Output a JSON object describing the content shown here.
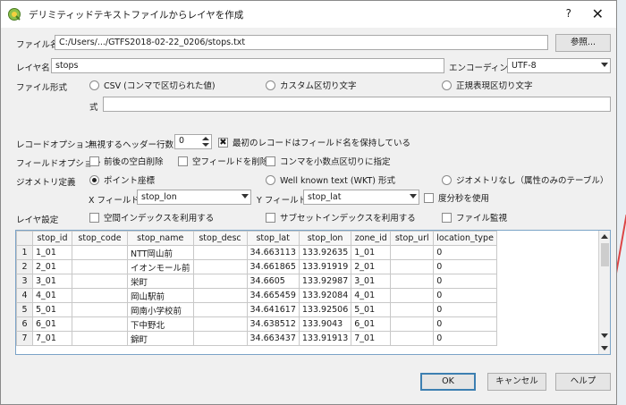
{
  "dialog": {
    "title": "デリミティッドテキストファイルからレイヤを作成",
    "help_glyph": "?",
    "close_glyph": "✕"
  },
  "file": {
    "label": "ファイル名",
    "value": "C:/Users/.../GTFS2018-02-22_0206/stops.txt",
    "browse": "参照..."
  },
  "layer": {
    "label": "レイヤ名",
    "value": "stops",
    "encoding_label": "エンコーディング",
    "encoding_value": "UTF-8"
  },
  "format": {
    "label": "ファイル形式",
    "options": [
      "CSV (コンマで区切られた値)",
      "カスタム区切り文字",
      "正規表現区切り文字"
    ],
    "expr_label": "式",
    "expr_value": ""
  },
  "record": {
    "label": "レコードオプション",
    "skip_header_label": "無視するヘッダー行数",
    "skip_header_value": "0",
    "first_row_names": "最初のレコードはフィールド名を保持している"
  },
  "field_opts": {
    "label": "フィールドオプション",
    "trim": "前後の空白削除",
    "discard_empty": "空フィールドを削除",
    "comma_decimal": "コンマを小数点区切りに指定"
  },
  "geometry": {
    "label": "ジオメトリ定義",
    "point": "ポイント座標",
    "wkt": "Well known text (WKT) 形式",
    "none": "ジオメトリなし（属性のみのテーブル）",
    "x_label": "X フィールド",
    "x_value": "stop_lon",
    "y_label": "Y フィールド",
    "y_value": "stop_lat",
    "dms": "度分秒を使用"
  },
  "layer_settings": {
    "label": "レイヤ設定",
    "spatial_index": "空間インデックスを利用する",
    "subset_index": "サブセットインデックスを利用する",
    "watch_file": "ファイル監視"
  },
  "table": {
    "columns": [
      "stop_id",
      "stop_code",
      "stop_name",
      "stop_desc",
      "stop_lat",
      "stop_lon",
      "zone_id",
      "stop_url",
      "location_type"
    ],
    "rows": [
      [
        "1",
        "1_01",
        "",
        "NTT岡山前",
        "",
        "34.663113",
        "133.92635",
        "1_01",
        "",
        "0"
      ],
      [
        "2",
        "2_01",
        "",
        "イオンモール前",
        "",
        "34.661865",
        "133.91919",
        "2_01",
        "",
        "0"
      ],
      [
        "3",
        "3_01",
        "",
        "栄町",
        "",
        "34.6605",
        "133.92987",
        "3_01",
        "",
        "0"
      ],
      [
        "4",
        "4_01",
        "",
        "岡山駅前",
        "",
        "34.665459",
        "133.92084",
        "4_01",
        "",
        "0"
      ],
      [
        "5",
        "5_01",
        "",
        "岡南小学校前",
        "",
        "34.641617",
        "133.92506",
        "5_01",
        "",
        "0"
      ],
      [
        "6",
        "6_01",
        "",
        "下中野北",
        "",
        "34.638512",
        "133.9043",
        "6_01",
        "",
        "0"
      ],
      [
        "7",
        "7_01",
        "",
        "錦町",
        "",
        "34.663437",
        "133.91913",
        "7_01",
        "",
        "0"
      ]
    ]
  },
  "buttons": {
    "ok": "OK",
    "cancel": "キャンセル",
    "help": "ヘルプ"
  }
}
